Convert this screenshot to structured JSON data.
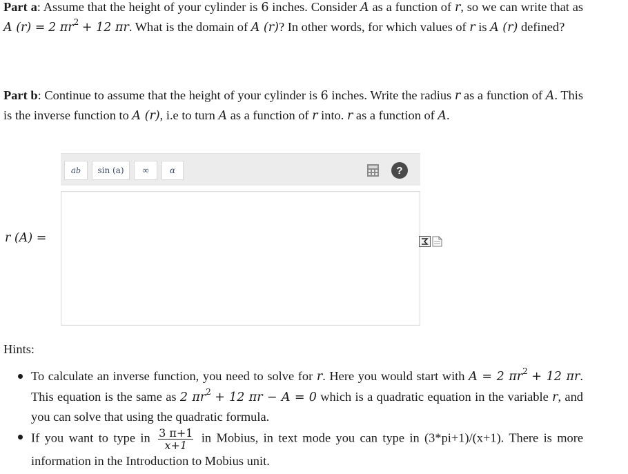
{
  "part_a": {
    "label": "Part a",
    "s1": ": Assume that the height of your cylinder is ",
    "height": "6",
    "s2": " inches. Consider ",
    "A": "A",
    "s3": " as a function of ",
    "r": "r",
    "s4": ", so we can write that as ",
    "expr_lhs": "A (r) =",
    "expr_rhs_1": "2 πr",
    "exp2": "2",
    "expr_rhs_2": "+ 12 πr",
    "s5": ". What is the domain of ",
    "expr_A_r": "A (r)",
    "s6": "? In other words, for which values of ",
    "s7": " is ",
    "s8": " defined?"
  },
  "part_b": {
    "label": "Part b",
    "s1": ": Continue to assume that the height of your cylinder is ",
    "height": "6",
    "s2": " inches. Write the radius ",
    "s3": " as a function of ",
    "s4": ". This is the inverse function to ",
    "s5": ", i.e to turn ",
    "s6": " as a function of ",
    "s7": " into. ",
    "s8": " as a function of ",
    "s9": "."
  },
  "editor": {
    "power_btn_base": "a",
    "power_btn_exp": "b",
    "func_btn": "sin (a)",
    "infinity_btn": "∞",
    "greek_btn": "α",
    "help_btn": "?",
    "answer_label": "r (A) =",
    "answer_value": ""
  },
  "hints": {
    "title": "Hints:",
    "h1_s1": "To calculate an inverse function, you need to solve for ",
    "h1_r": "r",
    "h1_s2": ". Here you would start with ",
    "h1_eq1_lhs": "A = 2 πr",
    "h1_eq1_rhs": "+ 12 πr",
    "h1_s3": ". This equation is the same as ",
    "h1_eq2_a": "2 πr",
    "h1_eq2_b": "+ 12 πr − A = 0",
    "h1_s4": " which is a quadratic equation in the variable ",
    "h1_s5": ", and you can solve that using the quadratic formula.",
    "h2_s1": "If you want to type in ",
    "h2_num": "3 π+1",
    "h2_den": "x+1",
    "h2_s2": " in Mobius, in text mode you can type in (3*pi+1)/(x+1). There is more information in the Introduction to Mobius unit."
  }
}
